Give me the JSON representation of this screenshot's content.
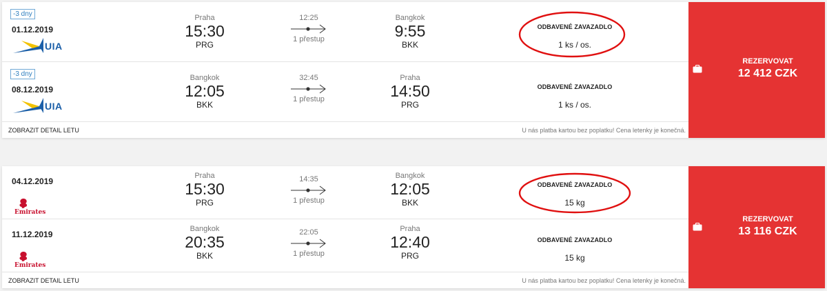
{
  "colors": {
    "book_bg": "#e53333",
    "highlight": "#e01010",
    "badge": "#2f7fbf"
  },
  "results": [
    {
      "segments": [
        {
          "badge": "-3 dny",
          "date": "01.12.2019",
          "airline_logo": "UIA",
          "dep_city": "Praha",
          "dep_time": "15:30",
          "dep_code": "PRG",
          "duration": "12:25",
          "stops": "1 přestup",
          "arr_city": "Bangkok",
          "arr_time": "9:55",
          "arr_code": "BKK",
          "baggage_title": "ODBAVENÉ ZAVAZADLO",
          "baggage_value": "1 ks / os."
        },
        {
          "badge": "-3 dny",
          "date": "08.12.2019",
          "airline_logo": "UIA",
          "dep_city": "Bangkok",
          "dep_time": "12:05",
          "dep_code": "BKK",
          "duration": "32:45",
          "stops": "1 přestup",
          "arr_city": "Praha",
          "arr_time": "14:50",
          "arr_code": "PRG",
          "baggage_title": "ODBAVENÉ ZAVAZADLO",
          "baggage_value": "1 ks / os."
        }
      ],
      "detail_link": "ZOBRAZIT DETAIL LETU",
      "note": "U nás platba kartou bez poplatku! Cena letenky je konečná.",
      "book_label": "REZERVOVAT",
      "price": "12 412 CZK"
    },
    {
      "segments": [
        {
          "date": "04.12.2019",
          "airline_logo": "Emirates",
          "dep_city": "Praha",
          "dep_time": "15:30",
          "dep_code": "PRG",
          "duration": "14:35",
          "stops": "1 přestup",
          "arr_city": "Bangkok",
          "arr_time": "12:05",
          "arr_code": "BKK",
          "baggage_title": "ODBAVENÉ ZAVAZADLO",
          "baggage_value": "15 kg"
        },
        {
          "date": "11.12.2019",
          "airline_logo": "Emirates",
          "dep_city": "Bangkok",
          "dep_time": "20:35",
          "dep_code": "BKK",
          "duration": "22:05",
          "stops": "1 přestup",
          "arr_city": "Praha",
          "arr_time": "12:40",
          "arr_code": "PRG",
          "baggage_title": "ODBAVENÉ ZAVAZADLO",
          "baggage_value": "15 kg"
        }
      ],
      "detail_link": "ZOBRAZIT DETAIL LETU",
      "note": "U nás platba kartou bez poplatku! Cena letenky je konečná.",
      "book_label": "REZERVOVAT",
      "price": "13 116 CZK"
    }
  ]
}
